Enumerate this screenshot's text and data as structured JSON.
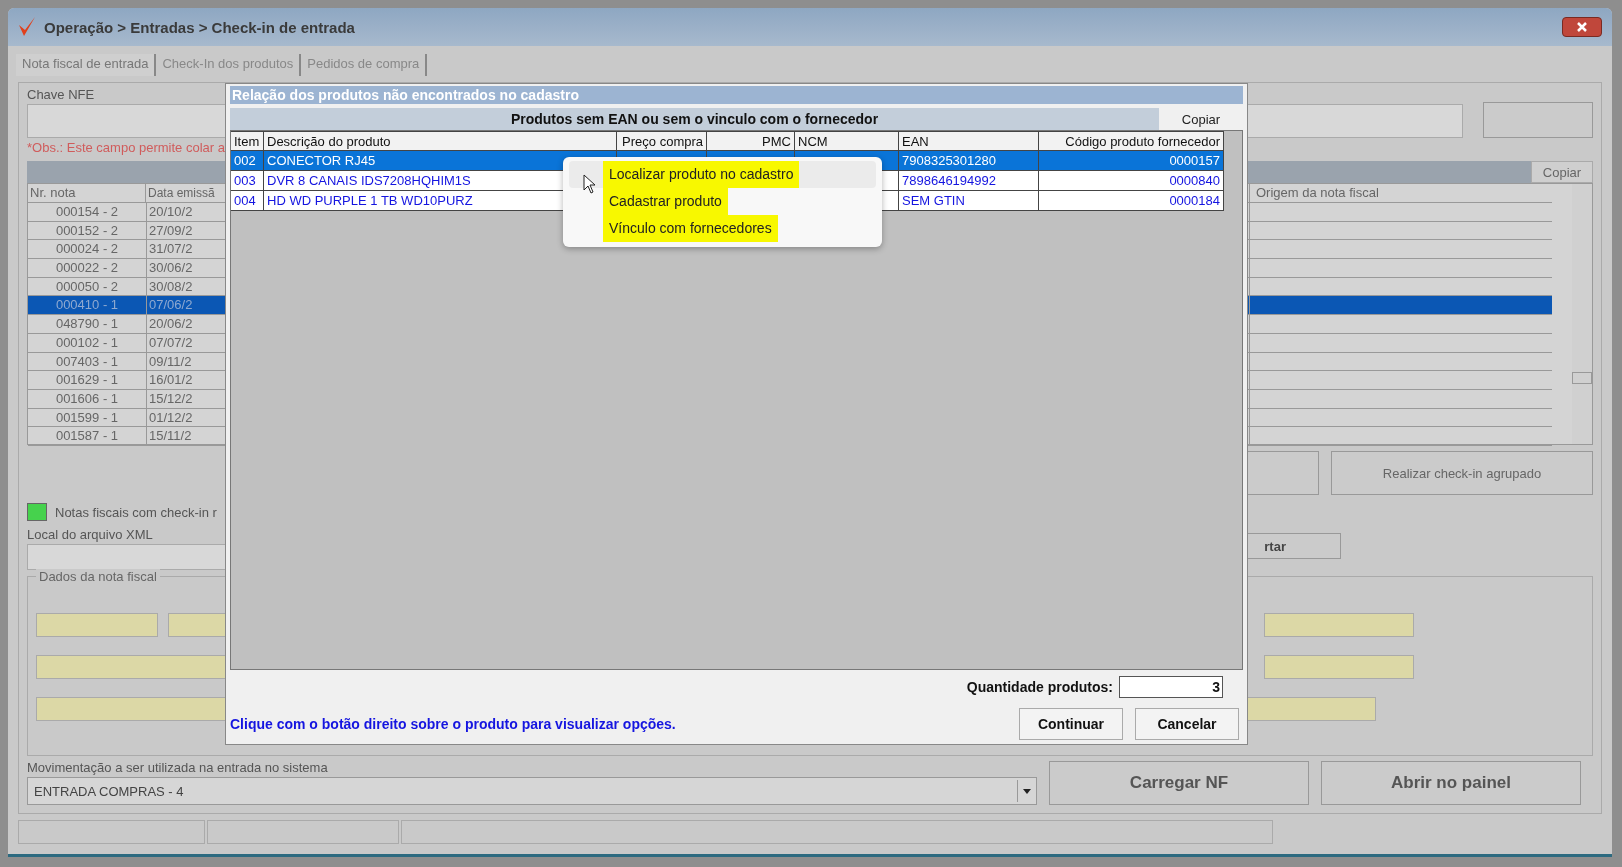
{
  "window": {
    "title": "Operação > Entradas > Check-in de entrada"
  },
  "tabs": [
    {
      "label": "Nota fiscal de entrada",
      "selected": true
    },
    {
      "label": "Check-In dos produtos",
      "selected": false
    },
    {
      "label": "Pedidos de compra",
      "selected": false
    }
  ],
  "chave_nfe": {
    "label": "Chave NFE",
    "note": "*Obs.: Este campo permite colar a"
  },
  "notes_grid": {
    "copy_button": "Copiar",
    "columns": [
      "Nr. nota",
      "Data emissã",
      "Origem da nota fiscal"
    ],
    "rows": [
      {
        "number": "000154 - 2",
        "date": "20/10/2",
        "selected": false
      },
      {
        "number": "000152 - 2",
        "date": "27/09/2",
        "selected": false
      },
      {
        "number": "000024 - 2",
        "date": "31/07/2",
        "selected": false
      },
      {
        "number": "000022 - 2",
        "date": "30/06/2",
        "selected": false
      },
      {
        "number": "000050 - 2",
        "date": "30/08/2",
        "selected": false
      },
      {
        "number": "000410 - 1",
        "date": "07/06/2",
        "selected": true
      },
      {
        "number": "048790 - 1",
        "date": "20/06/2",
        "selected": false
      },
      {
        "number": "000102 - 1",
        "date": "07/07/2",
        "selected": false
      },
      {
        "number": "007403 - 1",
        "date": "09/11/2",
        "selected": false
      },
      {
        "number": "001629 - 1",
        "date": "16/01/2",
        "selected": false
      },
      {
        "number": "001606 - 1",
        "date": "15/12/2",
        "selected": false
      },
      {
        "number": "001599 - 1",
        "date": "01/12/2",
        "selected": false
      },
      {
        "number": "001587 - 1",
        "date": "15/11/2",
        "selected": false
      }
    ]
  },
  "grouped_checkin_button": "Realizar check-in agrupado",
  "legend": {
    "label": "Notas fiscais com check-in r"
  },
  "xml": {
    "label": "Local do arquivo XML",
    "button": "rtar"
  },
  "invoice_data": {
    "title": "Dados da nota fiscal"
  },
  "movement": {
    "label": "Movimentação a ser utilizada na entrada no sistema",
    "value": "ENTRADA COMPRAS - 4"
  },
  "actions": [
    "Carregar NF",
    "Abrir no painel"
  ],
  "dialog": {
    "title": "Relação dos produtos não encontrados no cadastro",
    "subtitle": "Produtos sem EAN ou sem o vinculo com o fornecedor",
    "copy_button": "Copiar",
    "columns": [
      "Item",
      "Descrição do produto",
      "Preço compra",
      "PMC",
      "NCM",
      "EAN",
      "Código produto fornecedor"
    ],
    "rows": [
      {
        "item": "002",
        "description": "CONECTOR RJ45",
        "ean": "7908325301280",
        "supplier_code": "0000157",
        "selected": true
      },
      {
        "item": "003",
        "description": "DVR 8 CANAIS IDS7208HQHIM1S",
        "ean": "7898646194992",
        "supplier_code": "0000840",
        "selected": false
      },
      {
        "item": "004",
        "description": "HD WD PURPLE 1 TB WD10PURZ",
        "ean": "SEM GTIN",
        "supplier_code": "0000184",
        "selected": false
      }
    ],
    "quantity": {
      "label": "Quantidade produtos:",
      "value": "3"
    },
    "hint": "Clique com o botão direito sobre o produto para visualizar opções.",
    "buttons": [
      "Continuar",
      "Cancelar"
    ]
  },
  "context_menu": {
    "items": [
      {
        "label": "Localizar produto no cadastro",
        "selected": true
      },
      {
        "label": "Cadastrar produto",
        "selected": false
      },
      {
        "label": "Vínculo com fornecedores",
        "selected": false
      }
    ]
  }
}
